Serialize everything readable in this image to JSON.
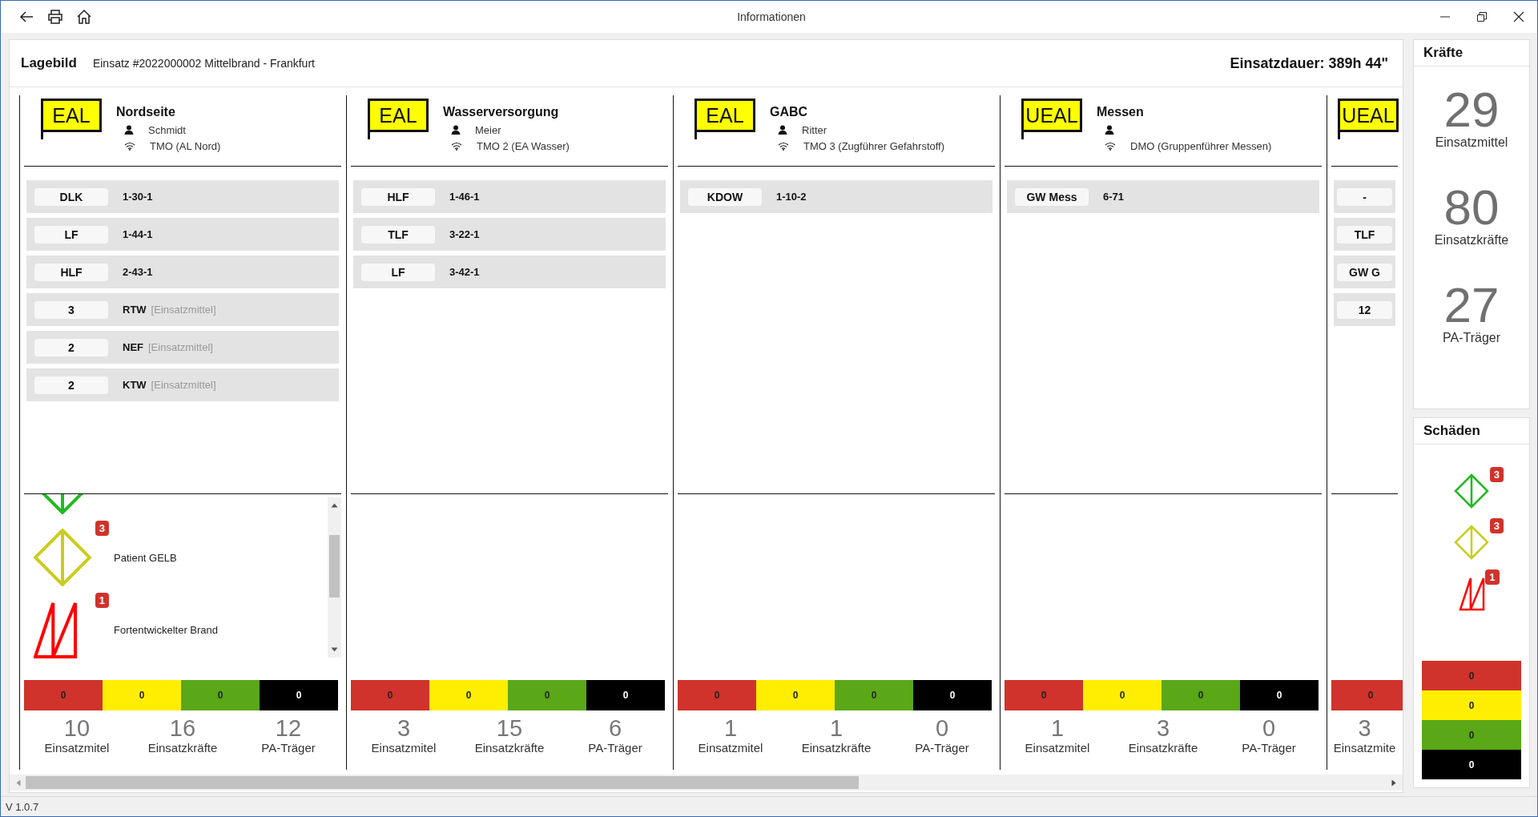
{
  "window": {
    "title": "Informationen"
  },
  "board": {
    "title": "Lagebild",
    "incident": "Einsatz #2022000002 Mittelbrand - Frankfurt",
    "duration": "Einsatzdauer: 389h 44\""
  },
  "sections": [
    {
      "sign": "EAL",
      "name": "Nordseite",
      "leader": "Schmidt",
      "radio": "TMO (AL Nord)",
      "vehicles": [
        {
          "type": "DLK",
          "callsign": "1-30-1"
        },
        {
          "type": "LF",
          "callsign": "1-44-1"
        },
        {
          "type": "HLF",
          "callsign": "2-43-1"
        },
        {
          "type": "3",
          "callsign": "RTW",
          "note": "[Einsatzmittel]"
        },
        {
          "type": "2",
          "callsign": "NEF",
          "note": "[Einsatzmittel]"
        },
        {
          "type": "2",
          "callsign": "KTW",
          "note": "[Einsatzmittel]"
        }
      ],
      "damages": [
        {
          "kind": "patient",
          "color": "#1fbb1f"
        },
        {
          "kind": "patient",
          "color": "#cccc1e",
          "count": "3",
          "label": "Patient GELB"
        },
        {
          "kind": "fire",
          "color": "#ff0000",
          "count": "1",
          "label": "Fortentwickelter Brand"
        }
      ],
      "patients": [
        {
          "value": "0",
          "color": "#cf332b"
        },
        {
          "value": "0",
          "color": "#ffee00"
        },
        {
          "value": "0",
          "color": "#5aa717"
        },
        {
          "value": "0",
          "color": "#000000"
        }
      ],
      "stats": [
        {
          "value": "10",
          "label": "Einsatzmitel"
        },
        {
          "value": "16",
          "label": "Einsatzkräfte"
        },
        {
          "value": "12",
          "label": "PA-Träger"
        }
      ]
    },
    {
      "sign": "EAL",
      "name": "Wasserversorgung",
      "leader": "Meier",
      "radio": "TMO 2 (EA Wasser)",
      "vehicles": [
        {
          "type": "HLF",
          "callsign": "1-46-1"
        },
        {
          "type": "TLF",
          "callsign": "3-22-1"
        },
        {
          "type": "LF",
          "callsign": "3-42-1"
        }
      ],
      "patients": [
        {
          "value": "0",
          "color": "#cf332b"
        },
        {
          "value": "0",
          "color": "#ffee00"
        },
        {
          "value": "0",
          "color": "#5aa717"
        },
        {
          "value": "0",
          "color": "#000000"
        }
      ],
      "stats": [
        {
          "value": "3",
          "label": "Einsatzmitel"
        },
        {
          "value": "15",
          "label": "Einsatzkräfte"
        },
        {
          "value": "6",
          "label": "PA-Träger"
        }
      ]
    },
    {
      "sign": "EAL",
      "name": "GABC",
      "leader": "Ritter",
      "radio": "TMO 3 (Zugführer Gefahrstoff)",
      "vehicles": [
        {
          "type": "KDOW",
          "callsign": "1-10-2"
        }
      ],
      "patients": [
        {
          "value": "0",
          "color": "#cf332b"
        },
        {
          "value": "0",
          "color": "#ffee00"
        },
        {
          "value": "0",
          "color": "#5aa717"
        },
        {
          "value": "0",
          "color": "#000000"
        }
      ],
      "stats": [
        {
          "value": "1",
          "label": "Einsatzmitel"
        },
        {
          "value": "1",
          "label": "Einsatzkräfte"
        },
        {
          "value": "0",
          "label": "PA-Träger"
        }
      ]
    },
    {
      "sign": "UEAL",
      "name": "Messen",
      "radio": "DMO (Gruppenführer Messen)",
      "vehicles": [
        {
          "type": "GW Mess",
          "callsign": "6-71"
        }
      ],
      "patients": [
        {
          "value": "0",
          "color": "#cf332b"
        },
        {
          "value": "0",
          "color": "#ffee00"
        },
        {
          "value": "0",
          "color": "#5aa717"
        },
        {
          "value": "0",
          "color": "#000000"
        }
      ],
      "stats": [
        {
          "value": "1",
          "label": "Einsatzmitel"
        },
        {
          "value": "3",
          "label": "Einsatzkräfte"
        },
        {
          "value": "0",
          "label": "PA-Träger"
        }
      ]
    },
    {
      "sign": "UEAL",
      "vehicles": [
        {
          "type": "-"
        },
        {
          "type": "TLF"
        },
        {
          "type": "GW G"
        },
        {
          "type": "12"
        }
      ],
      "patients": [
        {
          "value": "0",
          "color": "#cf332b"
        }
      ],
      "stats": [
        {
          "value": "3",
          "label": "Einsatzmite"
        }
      ]
    }
  ],
  "forces": {
    "title": "Kräfte",
    "stats": [
      {
        "value": "29",
        "label": "Einsatzmittel"
      },
      {
        "value": "80",
        "label": "Einsatzkräfte"
      },
      {
        "value": "27",
        "label": "PA-Träger"
      }
    ]
  },
  "damages": {
    "title": "Schäden",
    "items": [
      {
        "kind": "patient",
        "color": "#1fbb1f",
        "count": "3"
      },
      {
        "kind": "patient",
        "color": "#cccc1e",
        "count": "3"
      },
      {
        "kind": "fire",
        "color": "#ff0000",
        "count": "1"
      }
    ],
    "patients": [
      {
        "value": "0",
        "color": "#cf332b"
      },
      {
        "value": "0",
        "color": "#ffee00"
      },
      {
        "value": "0",
        "color": "#5aa717"
      },
      {
        "value": "0",
        "color": "#000000"
      }
    ]
  },
  "status_bar": {
    "version": "V 1.0.7"
  }
}
